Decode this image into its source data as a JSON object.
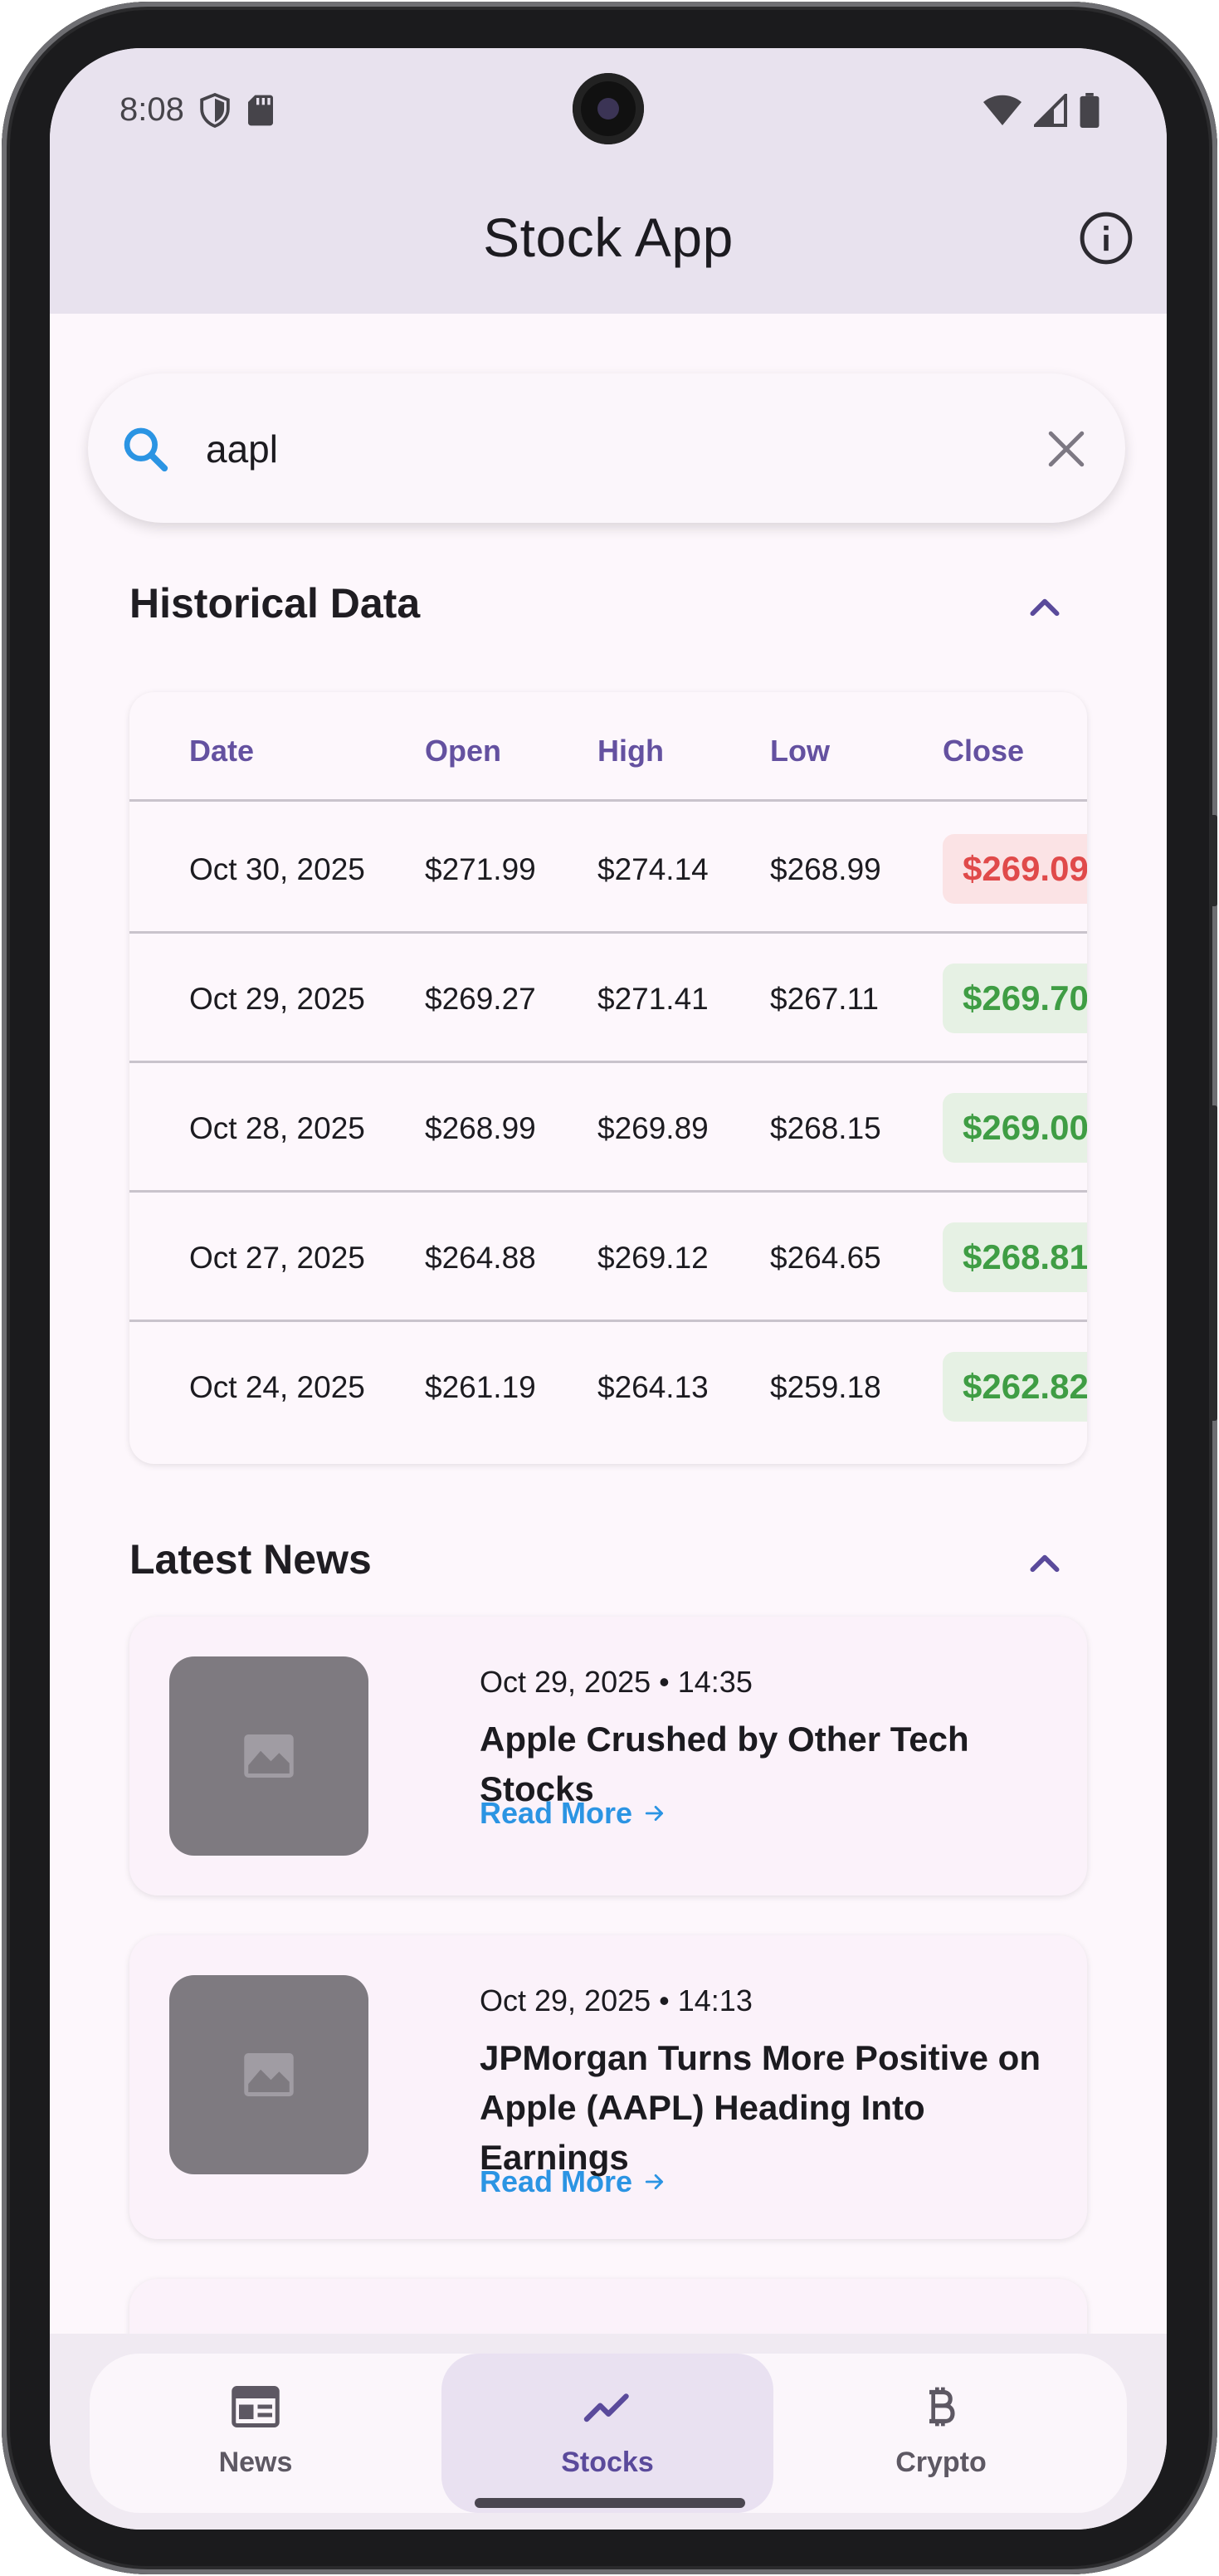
{
  "status_bar": {
    "time": "8:08"
  },
  "app_bar": {
    "title": "Stock App"
  },
  "search": {
    "value": "aapl"
  },
  "historical": {
    "title": "Historical Data",
    "columns": [
      "Date",
      "Open",
      "High",
      "Low",
      "Close"
    ],
    "rows": [
      {
        "date": "Oct 30, 2025",
        "open": "$271.99",
        "high": "$274.14",
        "low": "$268.99",
        "close": "$269.09",
        "direction": "down"
      },
      {
        "date": "Oct 29, 2025",
        "open": "$269.27",
        "high": "$271.41",
        "low": "$267.11",
        "close": "$269.70",
        "direction": "up"
      },
      {
        "date": "Oct 28, 2025",
        "open": "$268.99",
        "high": "$269.89",
        "low": "$268.15",
        "close": "$269.00",
        "direction": "up"
      },
      {
        "date": "Oct 27, 2025",
        "open": "$264.88",
        "high": "$269.12",
        "low": "$264.65",
        "close": "$268.81",
        "direction": "up"
      },
      {
        "date": "Oct 24, 2025",
        "open": "$261.19",
        "high": "$264.13",
        "low": "$259.18",
        "close": "$262.82",
        "direction": "up"
      }
    ]
  },
  "news": {
    "title": "Latest News",
    "items": [
      {
        "date": "Oct 29, 2025 • 14:35",
        "title": "Apple Crushed by Other Tech Stocks",
        "link": "Read More"
      },
      {
        "date": "Oct 29, 2025 • 14:13",
        "title": "JPMorgan Turns More Positive on Apple (AAPL) Heading Into Earnings",
        "link": "Read More"
      }
    ]
  },
  "bottom_nav": {
    "items": [
      {
        "label": "News",
        "icon": "newspaper-icon"
      },
      {
        "label": "Stocks",
        "icon": "trending-up-icon",
        "active": true
      },
      {
        "label": "Crypto",
        "icon": "bitcoin-icon"
      }
    ]
  },
  "colors": {
    "accent": "#6451a0",
    "link": "#2b94e3",
    "up": "#3f9d44",
    "down": "#e04a4a",
    "app_bar": "#e8e2ee"
  }
}
